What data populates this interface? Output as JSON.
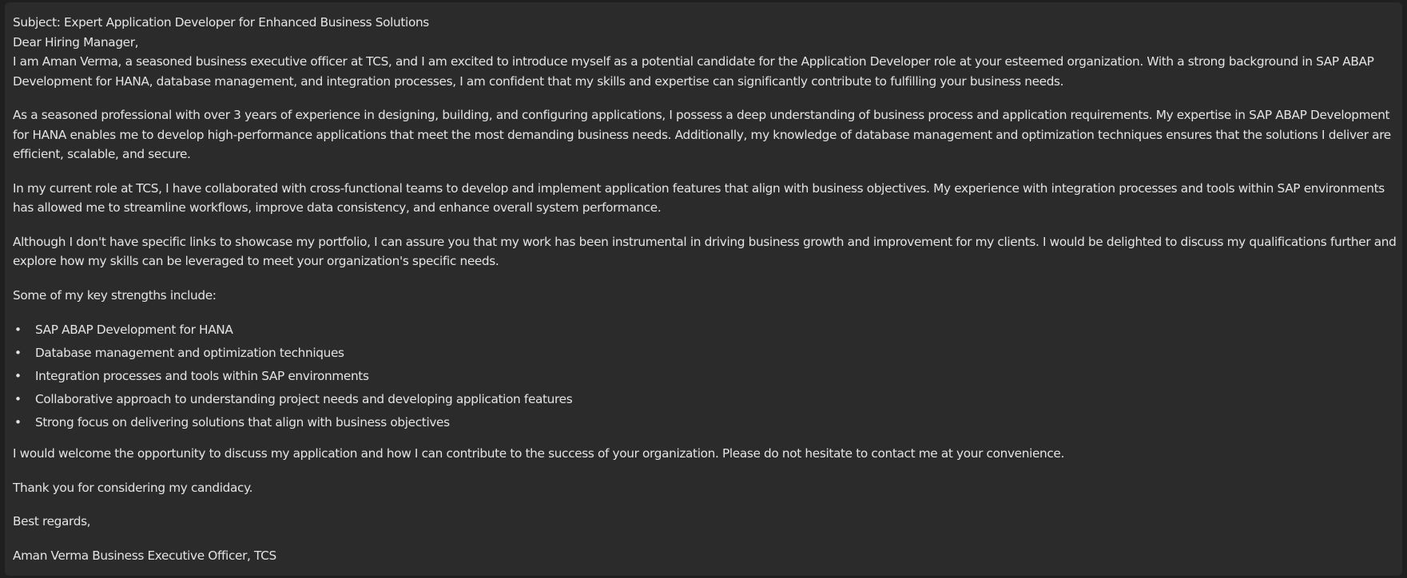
{
  "email": {
    "subject": "Subject: Expert Application Developer for Enhanced Business Solutions",
    "greeting": "Dear Hiring Manager,",
    "paragraphs": [
      "I am Aman Verma, a seasoned business executive officer at TCS, and I am excited to introduce myself as a potential candidate for the Application Developer role at your esteemed organization. With a strong background in SAP ABAP Development for HANA, database management, and integration processes, I am confident that my skills and expertise can significantly contribute to fulfilling your business needs.",
      "As a seasoned professional with over 3 years of experience in designing, building, and configuring applications, I possess a deep understanding of business process and application requirements. My expertise in SAP ABAP Development for HANA enables me to develop high-performance applications that meet the most demanding business needs. Additionally, my knowledge of database management and optimization techniques ensures that the solutions I deliver are efficient, scalable, and secure.",
      "In my current role at TCS, I have collaborated with cross-functional teams to develop and implement application features that align with business objectives. My experience with integration processes and tools within SAP environments has allowed me to streamline workflows, improve data consistency, and enhance overall system performance.",
      "Although I don't have specific links to showcase my portfolio, I can assure you that my work has been instrumental in driving business growth and improvement for my clients. I would be delighted to discuss my qualifications further and explore how my skills can be leveraged to meet your organization's specific needs.",
      "Some of my key strengths include:"
    ],
    "bullet_glyph": "•",
    "strengths": [
      "SAP ABAP Development for HANA",
      "Database management and optimization techniques",
      "Integration processes and tools within SAP environments",
      "Collaborative approach to understanding project needs and developing application features",
      "Strong focus on delivering solutions that align with business objectives"
    ],
    "closing_paragraph": "I would welcome the opportunity to discuss my application and how I can contribute to the success of your organization. Please do not hesitate to contact me at your convenience.",
    "thanks": "Thank you for considering my candidacy.",
    "sign_off": "Best regards,",
    "signature": "Aman Verma Business Executive Officer, TCS"
  },
  "colors": {
    "background": "#1f1f1f",
    "panel": "#2b2b2b",
    "text": "#e4e4e4"
  }
}
